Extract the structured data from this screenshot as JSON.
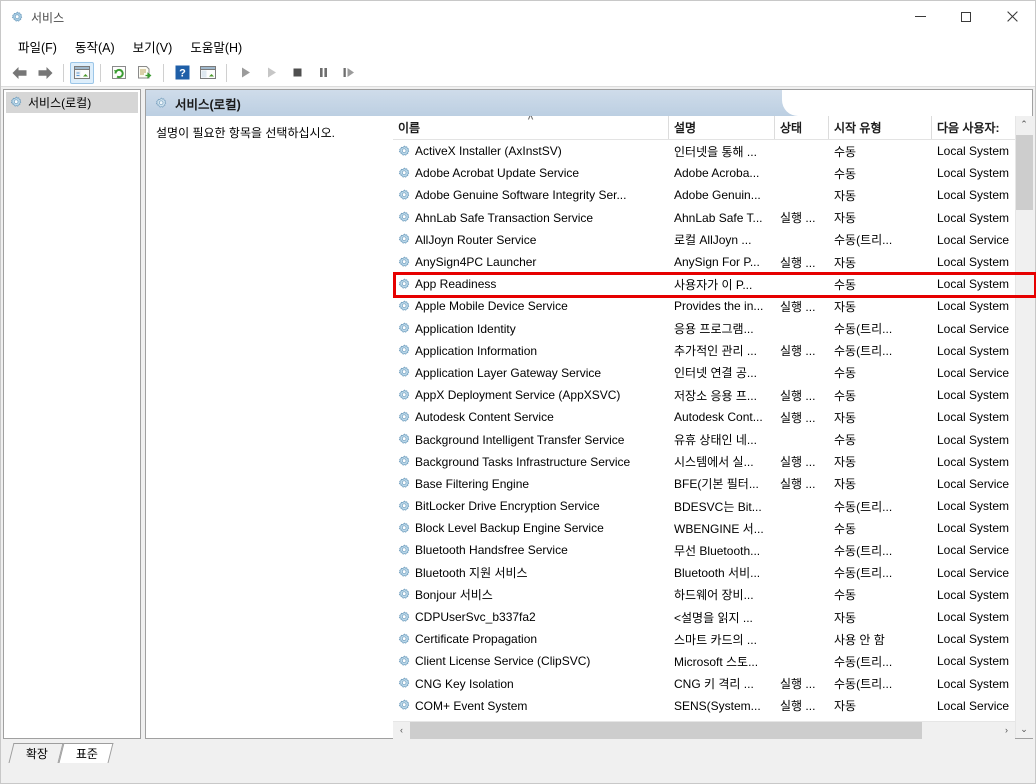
{
  "window": {
    "title": "서비스",
    "app_icon": "services-gear-icon",
    "minimize_label": "–",
    "maximize_label": "□",
    "close_label": "✕"
  },
  "menubar": {
    "items": [
      {
        "label": "파일(F)",
        "name": "menu-file"
      },
      {
        "label": "동작(A)",
        "name": "menu-action"
      },
      {
        "label": "보기(V)",
        "name": "menu-view"
      },
      {
        "label": "도움말(H)",
        "name": "menu-help"
      }
    ]
  },
  "toolbar": {
    "buttons": [
      {
        "name": "back-button",
        "icon": "arrow-left-icon",
        "active": false
      },
      {
        "name": "forward-button",
        "icon": "arrow-right-icon",
        "active": false
      },
      {
        "name": "show-hide-tree-button",
        "icon": "tree-pane-icon",
        "active": true
      },
      {
        "name": "refresh-button",
        "icon": "refresh-icon",
        "active": false
      },
      {
        "name": "export-list-button",
        "icon": "export-icon",
        "active": false
      },
      {
        "name": "help-button",
        "icon": "question-mark-icon",
        "active": false
      },
      {
        "name": "properties-button",
        "icon": "properties-window-icon",
        "active": false
      },
      {
        "name": "start-service-button",
        "icon": "play-icon",
        "active": false
      },
      {
        "name": "resume-service-button",
        "icon": "play-outline-icon",
        "active": false
      },
      {
        "name": "stop-service-button",
        "icon": "stop-square-icon",
        "active": false
      },
      {
        "name": "pause-service-button",
        "icon": "pause-icon",
        "active": false
      },
      {
        "name": "restart-service-button",
        "icon": "restart-icon",
        "active": false
      }
    ]
  },
  "tree": {
    "items": [
      {
        "label": "서비스(로컬)",
        "selected": true
      }
    ]
  },
  "result_pane": {
    "header_title": "서비스(로컬)",
    "description_prompt": "설명이 필요한 항목을 선택하십시오."
  },
  "list": {
    "sort_column": "이름",
    "sort_direction": "ascending",
    "columns": [
      {
        "label": "이름",
        "key": "name"
      },
      {
        "label": "설명",
        "key": "description"
      },
      {
        "label": "상태",
        "key": "status"
      },
      {
        "label": "시작 유형",
        "key": "startup"
      },
      {
        "label": "다음 사용자:",
        "key": "logon"
      }
    ],
    "rows": [
      {
        "name": "ActiveX Installer (AxInstSV)",
        "description": "인터넷을 통해 ...",
        "status": "",
        "startup": "수동",
        "logon": "Local System",
        "highlighted": false
      },
      {
        "name": "Adobe Acrobat Update Service",
        "description": "Adobe Acroba...",
        "status": "",
        "startup": "수동",
        "logon": "Local System",
        "highlighted": false
      },
      {
        "name": "Adobe Genuine Software Integrity Ser...",
        "description": "Adobe Genuin...",
        "status": "",
        "startup": "자동",
        "logon": "Local System",
        "highlighted": false
      },
      {
        "name": "AhnLab Safe Transaction Service",
        "description": "AhnLab Safe T...",
        "status": "실행 ...",
        "startup": "자동",
        "logon": "Local System",
        "highlighted": false
      },
      {
        "name": "AllJoyn Router Service",
        "description": "로컬 AllJoyn ...",
        "status": "",
        "startup": "수동(트리...",
        "logon": "Local Service",
        "highlighted": false
      },
      {
        "name": "AnySign4PC Launcher",
        "description": "AnySign For P...",
        "status": "실행 ...",
        "startup": "자동",
        "logon": "Local System",
        "highlighted": false
      },
      {
        "name": "App Readiness",
        "description": "사용자가 이 P...",
        "status": "",
        "startup": "수동",
        "logon": "Local System",
        "highlighted": true
      },
      {
        "name": "Apple Mobile Device Service",
        "description": "Provides the in...",
        "status": "실행 ...",
        "startup": "자동",
        "logon": "Local System",
        "highlighted": false
      },
      {
        "name": "Application Identity",
        "description": "응용 프로그램...",
        "status": "",
        "startup": "수동(트리...",
        "logon": "Local Service",
        "highlighted": false
      },
      {
        "name": "Application Information",
        "description": "추가적인 관리 ...",
        "status": "실행 ...",
        "startup": "수동(트리...",
        "logon": "Local System",
        "highlighted": false
      },
      {
        "name": "Application Layer Gateway Service",
        "description": "인터넷 연결 공...",
        "status": "",
        "startup": "수동",
        "logon": "Local Service",
        "highlighted": false
      },
      {
        "name": "AppX Deployment Service (AppXSVC)",
        "description": "저장소 응용 프...",
        "status": "실행 ...",
        "startup": "수동",
        "logon": "Local System",
        "highlighted": false
      },
      {
        "name": "Autodesk Content Service",
        "description": "Autodesk Cont...",
        "status": "실행 ...",
        "startup": "자동",
        "logon": "Local System",
        "highlighted": false
      },
      {
        "name": "Background Intelligent Transfer Service",
        "description": "유휴 상태인 네...",
        "status": "",
        "startup": "수동",
        "logon": "Local System",
        "highlighted": false
      },
      {
        "name": "Background Tasks Infrastructure Service",
        "description": "시스템에서 실...",
        "status": "실행 ...",
        "startup": "자동",
        "logon": "Local System",
        "highlighted": false
      },
      {
        "name": "Base Filtering Engine",
        "description": "BFE(기본 필터...",
        "status": "실행 ...",
        "startup": "자동",
        "logon": "Local Service",
        "highlighted": false
      },
      {
        "name": "BitLocker Drive Encryption Service",
        "description": "BDESVC는 Bit...",
        "status": "",
        "startup": "수동(트리...",
        "logon": "Local System",
        "highlighted": false
      },
      {
        "name": "Block Level Backup Engine Service",
        "description": "WBENGINE 서...",
        "status": "",
        "startup": "수동",
        "logon": "Local System",
        "highlighted": false
      },
      {
        "name": "Bluetooth Handsfree Service",
        "description": "무선 Bluetooth...",
        "status": "",
        "startup": "수동(트리...",
        "logon": "Local Service",
        "highlighted": false
      },
      {
        "name": "Bluetooth 지원 서비스",
        "description": "Bluetooth 서비...",
        "status": "",
        "startup": "수동(트리...",
        "logon": "Local Service",
        "highlighted": false
      },
      {
        "name": "Bonjour 서비스",
        "description": "하드웨어 장비...",
        "status": "",
        "startup": "수동",
        "logon": "Local System",
        "highlighted": false
      },
      {
        "name": "CDPUserSvc_b337fa2",
        "description": "<설명을 읽지 ...",
        "status": "",
        "startup": "자동",
        "logon": "Local System",
        "highlighted": false
      },
      {
        "name": "Certificate Propagation",
        "description": "스마트 카드의 ...",
        "status": "",
        "startup": "사용 안 함",
        "logon": "Local System",
        "highlighted": false
      },
      {
        "name": "Client License Service (ClipSVC)",
        "description": "Microsoft 스토...",
        "status": "",
        "startup": "수동(트리...",
        "logon": "Local System",
        "highlighted": false
      },
      {
        "name": "CNG Key Isolation",
        "description": "CNG 키 격리 ...",
        "status": "실행 ...",
        "startup": "수동(트리...",
        "logon": "Local System",
        "highlighted": false
      },
      {
        "name": "COM+ Event System",
        "description": "SENS(System...",
        "status": "실행 ...",
        "startup": "자동",
        "logon": "Local Service",
        "highlighted": false
      }
    ]
  },
  "scrollbars": {
    "vertical_up_label": "⌃",
    "vertical_down_label": "⌄",
    "horizontal_left_label": "‹",
    "horizontal_right_label": "›"
  },
  "tabs": {
    "items": [
      {
        "label": "확장",
        "active": false
      },
      {
        "label": "표준",
        "active": true
      }
    ]
  },
  "annotation": {
    "color": "#e60000",
    "target_row": "App Readiness"
  }
}
